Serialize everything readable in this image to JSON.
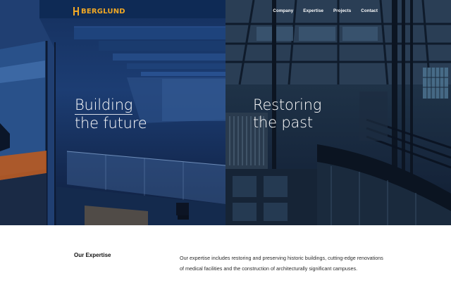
{
  "brand": {
    "name": "BERGLUND",
    "accent_color": "#f0a825"
  },
  "nav": {
    "items": [
      {
        "label": "Company"
      },
      {
        "label": "Expertise"
      },
      {
        "label": "Projects"
      },
      {
        "label": "Contact"
      }
    ]
  },
  "hero": {
    "left": {
      "line1": "Building",
      "line2": "the future",
      "tint": "#1c3d73"
    },
    "right": {
      "line1": "Restoring",
      "line2": "the past",
      "tint": "#1d3045"
    }
  },
  "expertise": {
    "title": "Our Expertise",
    "body": "Our expertise includes restoring and preserving historic buildings, cutting-edge renovations of medical facilities and the construction of architecturally significant campuses."
  }
}
